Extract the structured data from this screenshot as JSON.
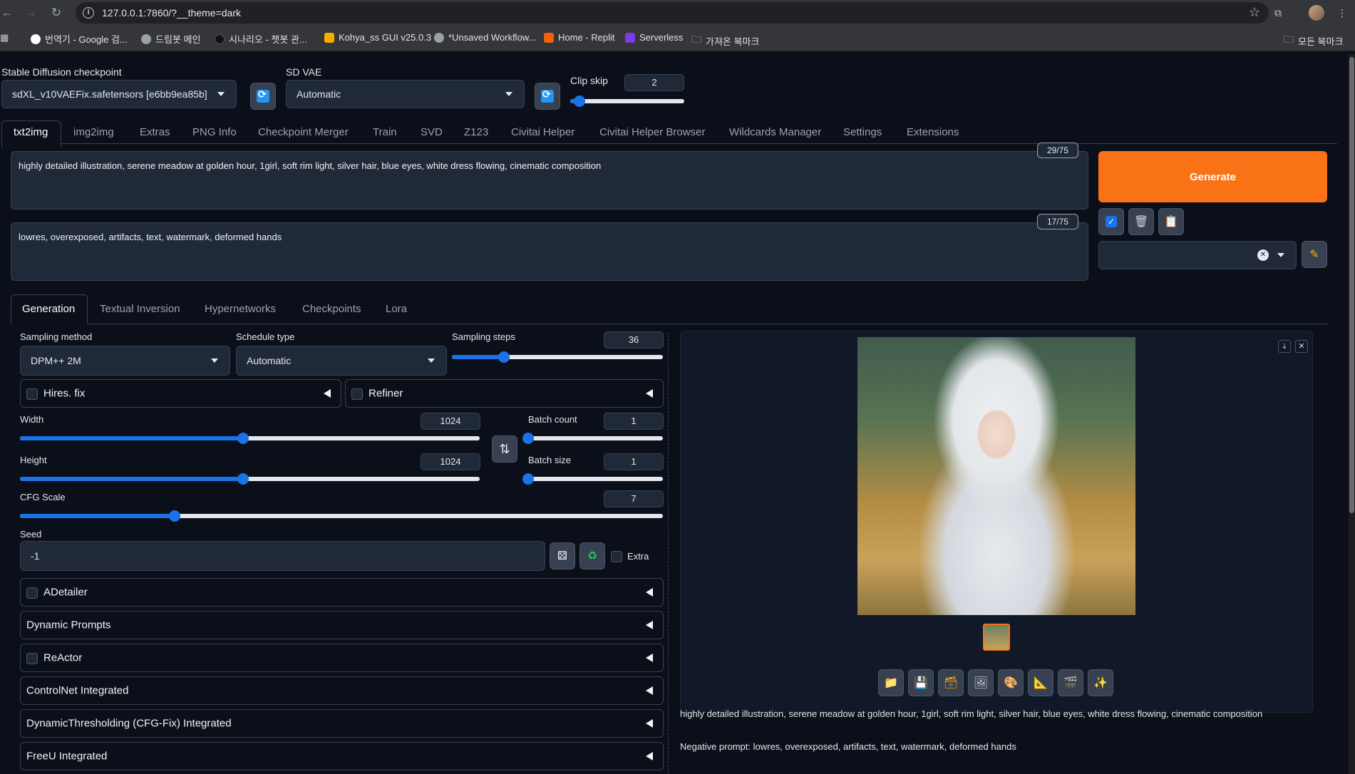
{
  "browser": {
    "url": "127.0.0.1:7860/?__theme=dark",
    "bookmarks": [
      {
        "label": "번역기 - Google 검...",
        "color": "#4285f4"
      },
      {
        "label": "드림봇 메인",
        "color": "#9aa0a6"
      },
      {
        "label": "시나리오 - 챗봇 관...",
        "color": "#202124"
      },
      {
        "label": "Kohya_ss GUI v25.0.3",
        "color": "#f9ab00"
      },
      {
        "label": "*Unsaved Workflow...",
        "color": "#9aa0a6"
      },
      {
        "label": "Home - Replit",
        "color": "#f26207"
      },
      {
        "label": "Serverless",
        "color": "#7c3aed"
      },
      {
        "label": "가져온 북마크",
        "color": "folder"
      }
    ],
    "all_bookmarks": "모든 북마크"
  },
  "top": {
    "checkpoint_label": "Stable Diffusion checkpoint",
    "checkpoint_value": "sdXL_v10VAEFix.safetensors [e6bb9ea85b]",
    "vae_label": "SD VAE",
    "vae_value": "Automatic",
    "clip_label": "Clip skip",
    "clip_value": "2",
    "clip_fraction": 0.083
  },
  "main_tabs": [
    "txt2img",
    "img2img",
    "Extras",
    "PNG Info",
    "Checkpoint Merger",
    "Train",
    "SVD",
    "Z123",
    "Civitai Helper",
    "Civitai Helper Browser",
    "Wildcards Manager",
    "Settings",
    "Extensions"
  ],
  "prompt": {
    "positive": "highly detailed illustration, serene meadow at golden hour, 1girl, soft rim light, silver hair, blue eyes, white dress flowing, cinematic composition",
    "positive_count": "29/75",
    "negative": "lowres, overexposed, artifacts, text, watermark, deformed hands",
    "negative_count": "17/75"
  },
  "actions": {
    "generate": "Generate",
    "style_clear": "✕"
  },
  "sub_tabs": [
    "Generation",
    "Textual Inversion",
    "Hypernetworks",
    "Checkpoints",
    "Lora"
  ],
  "generation": {
    "sampling_method_label": "Sampling method",
    "sampling_method": "DPM++ 2M",
    "schedule_label": "Schedule type",
    "schedule": "Automatic",
    "steps_label": "Sampling steps",
    "steps": "36",
    "steps_fraction": 0.245,
    "hires_label": "Hires. fix",
    "refiner_label": "Refiner",
    "width_label": "Width",
    "width": "1024",
    "width_fraction": 0.485,
    "height_label": "Height",
    "height": "1024",
    "height_fraction": 0.485,
    "batch_count_label": "Batch count",
    "batch_count": "1",
    "batch_size_label": "Batch size",
    "batch_size": "1",
    "cfg_label": "CFG Scale",
    "cfg": "7",
    "cfg_fraction": 0.241,
    "seed_label": "Seed",
    "seed": "-1",
    "extra_label": "Extra"
  },
  "accordions": [
    {
      "label": "ADetailer",
      "checkbox": true
    },
    {
      "label": "Dynamic Prompts",
      "checkbox": false
    },
    {
      "label": "ReActor",
      "checkbox": true
    },
    {
      "label": "ControlNet Integrated",
      "checkbox": false
    },
    {
      "label": "DynamicThresholding (CFG-Fix) Integrated",
      "checkbox": false
    },
    {
      "label": "FreeU Integrated",
      "checkbox": false
    }
  ],
  "output": {
    "info_prompt": "highly detailed illustration, serene meadow at golden hour, 1girl, soft rim light, silver hair, blue eyes, white dress flowing, cinematic composition",
    "info_negative": "Negative prompt: lowres, overexposed, artifacts, text, watermark, deformed hands"
  },
  "colors": {
    "accent": "#1a73e8",
    "generate": "#f97316",
    "background": "#0b0f19"
  }
}
